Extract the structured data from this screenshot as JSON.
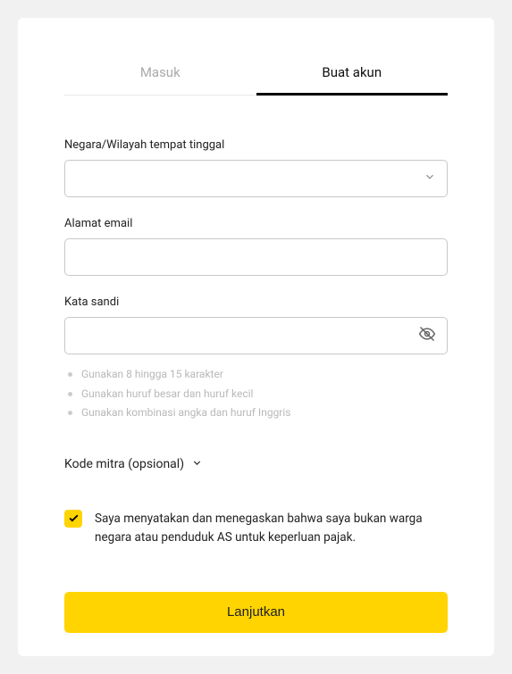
{
  "tabs": {
    "signin": "Masuk",
    "signup": "Buat akun",
    "active": "signup"
  },
  "country": {
    "label": "Negara/Wilayah tempat tinggal",
    "value": ""
  },
  "email": {
    "label": "Alamat email",
    "value": ""
  },
  "password": {
    "label": "Kata sandi",
    "value": "",
    "hints": [
      "Gunakan 8 hingga 15 karakter",
      "Gunakan huruf besar dan huruf kecil",
      "Gunakan kombinasi angka dan huruf Inggris"
    ]
  },
  "partner_code": {
    "label": "Kode mitra (opsional)"
  },
  "declaration": {
    "checked": true,
    "text": "Saya menyatakan dan menegaskan bahwa saya bukan warga negara atau penduduk AS untuk keperluan pajak."
  },
  "submit": {
    "label": "Lanjutkan"
  }
}
